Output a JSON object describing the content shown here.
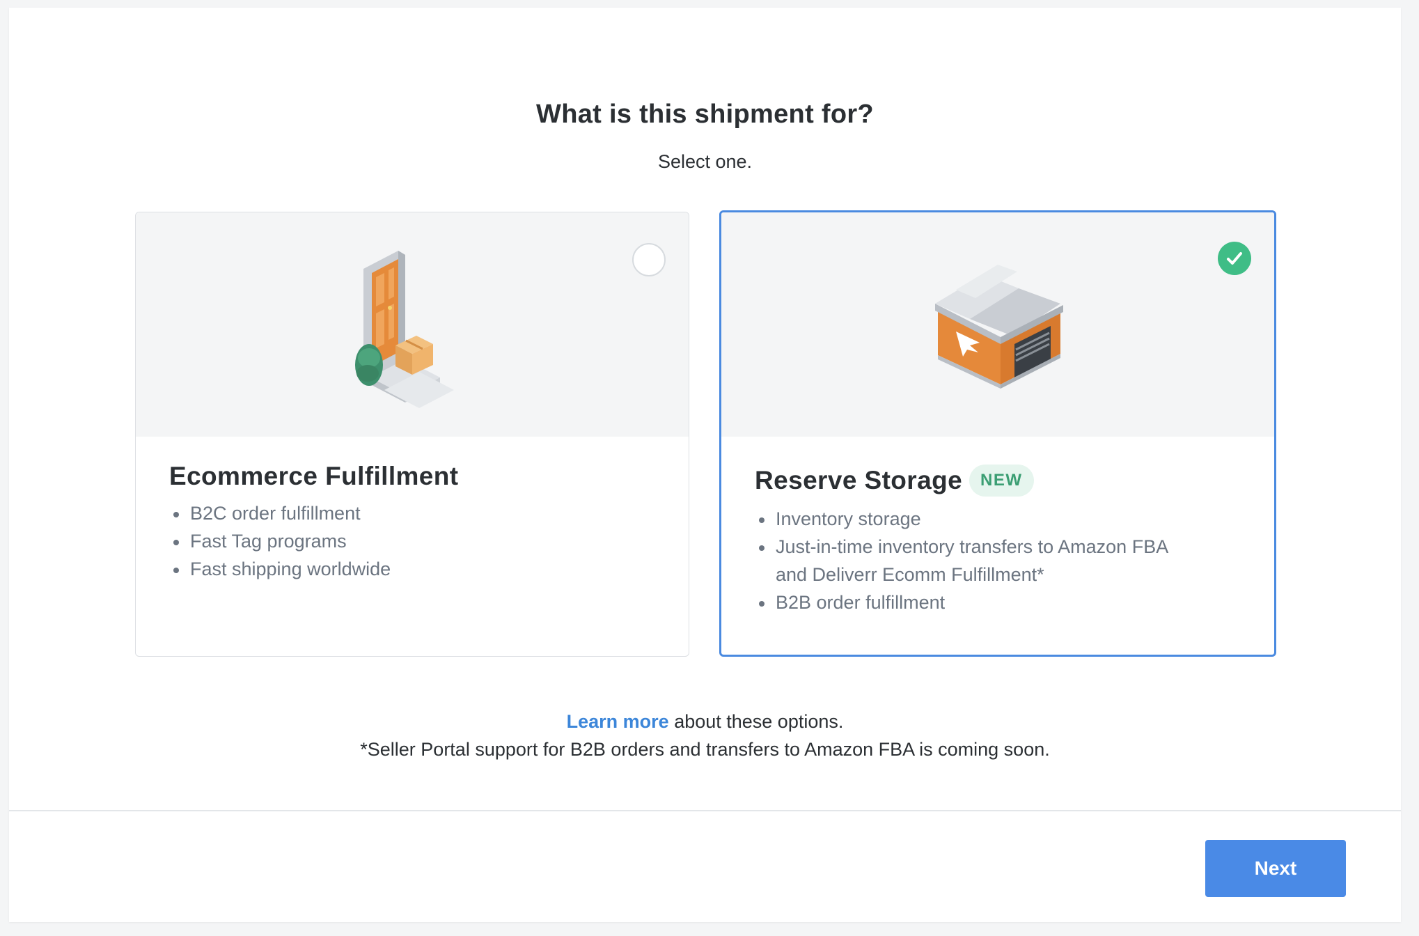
{
  "header": {
    "title": "What is this shipment for?",
    "subtitle": "Select one."
  },
  "options": [
    {
      "title": "Ecommerce Fulfillment",
      "selected": false,
      "illustration": "door-package-icon",
      "items": [
        "B2C order fulfillment",
        "Fast Tag programs",
        "Fast shipping worldwide"
      ]
    },
    {
      "title": "Reserve Storage",
      "badge": "NEW",
      "selected": true,
      "illustration": "warehouse-icon",
      "items": [
        "Inventory storage",
        "Just-in-time inventory transfers to Amazon FBA and Deliverr Ecomm Fulfillment*",
        "B2B order fulfillment"
      ]
    }
  ],
  "footer": {
    "learn_more": "Learn more",
    "learn_more_suffix": " about these options.",
    "note": "*Seller Portal support for B2B orders and transfers to Amazon FBA is coming soon."
  },
  "actions": {
    "next_label": "Next"
  },
  "colors": {
    "accent": "#4a8ae6",
    "success": "#3fbd86",
    "badge_bg": "#e6f5ee",
    "badge_text": "#3b9e73"
  }
}
